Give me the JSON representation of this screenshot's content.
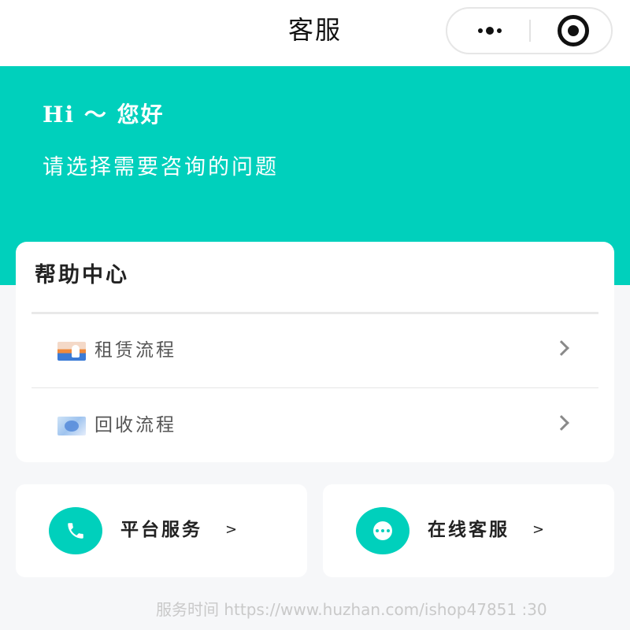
{
  "navbar": {
    "title": "客服",
    "menu_icon": "more-dots-icon",
    "close_icon": "target-icon"
  },
  "hero": {
    "greeting": "Hi ～ 您好",
    "subtitle": "请选择需要咨询的问题",
    "bg_color": "#00d0bc"
  },
  "help_center": {
    "title": "帮助中心",
    "items": [
      {
        "label": "租赁流程",
        "icon": "lease-thumbnail"
      },
      {
        "label": "回收流程",
        "icon": "recycle-thumbnail"
      }
    ]
  },
  "services": [
    {
      "label": "平台服务",
      "arrow": ">",
      "icon": "phone-icon"
    },
    {
      "label": "在线客服",
      "arrow": ">",
      "icon": "chat-dots-icon"
    }
  ],
  "watermark": "服务时间 https://www.huzhan.com/ishop47851 :30"
}
